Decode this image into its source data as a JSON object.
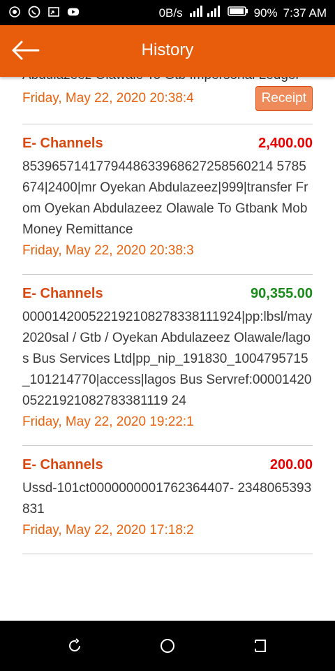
{
  "status_bar": {
    "left_icons": [
      "notification-icon",
      "whatsapp-icon",
      "screen-mirror-icon",
      "youtube-icon"
    ],
    "net_speed": "0B/s",
    "battery_pct": "90%",
    "time": "7:37 AM"
  },
  "header": {
    "title": "History"
  },
  "entries": [
    {
      "channel": "",
      "amount": "",
      "description": "Abdulazeez Olawale To Gtb Impersonal Ledger",
      "date": "Friday, May 22, 2020 20:38:4",
      "receipt_label": "Receipt"
    },
    {
      "channel": "E- Channels",
      "amount": "2,400.00",
      "amount_color": "#e60000",
      "description": "8539657141779448633968627258560214 5785674|2400|mr Oyekan Abdulazeez|999|transfer From Oyekan Abdulazeez Olawale To Gtbank Mob Money Remittance",
      "date": "Friday, May 22, 2020 20:38:3"
    },
    {
      "channel": "E- Channels",
      "amount": "90,355.00",
      "amount_color": "#1a8a1a",
      "description": "000014200522192108278338111924|pp:lbsl/may2020sal / Gtb / Oyekan Abdulazeez Olawale/lagos Bus Services Ltd|pp_nip_191830_1004795715_101214770|access|lagos Bus Servref:0000142005221921082783381119 24",
      "date": "Friday, May 22, 2020 19:22:1"
    },
    {
      "channel": "E- Channels",
      "amount": "200.00",
      "amount_color": "#e60000",
      "description": "Ussd-101ct0000000001762364407- 2348065393831",
      "date": "Friday, May 22, 2020 17:18:2"
    }
  ],
  "nav_bar": {
    "icons": [
      "recents-icon",
      "home-icon",
      "back-icon"
    ]
  }
}
